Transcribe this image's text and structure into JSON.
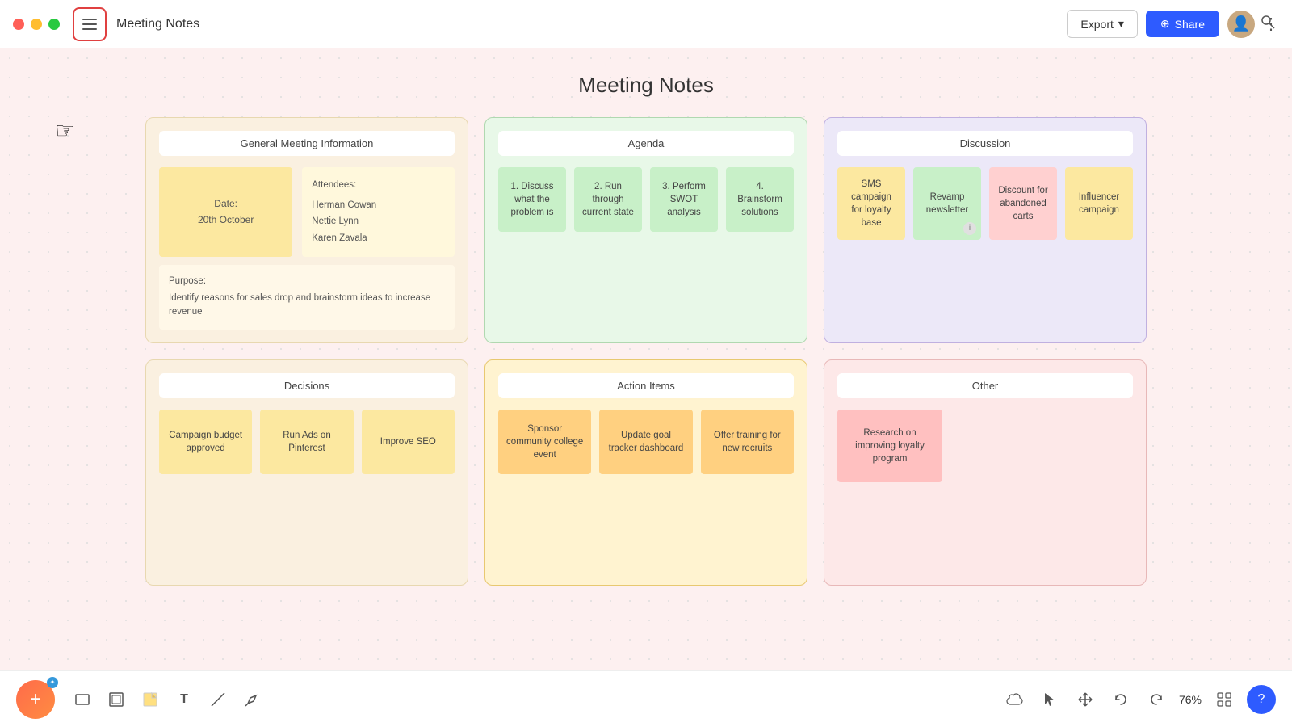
{
  "titleBar": {
    "docTitle": "Meeting Notes",
    "exportLabel": "Export",
    "shareLabel": "Share",
    "moreLabel": "⋮"
  },
  "page": {
    "title": "Meeting Notes"
  },
  "sections": {
    "general": {
      "header": "General Meeting Information",
      "dateLabel": "Date:",
      "dateValue": "20th October",
      "attendeesLabel": "Attendees:",
      "attendee1": "Herman Cowan",
      "attendee2": "Nettie Lynn",
      "attendee3": "Karen Zavala",
      "purposeLabel": "Purpose:",
      "purposeText": "Identify reasons for sales drop and brainstorm ideas to increase revenue"
    },
    "agenda": {
      "header": "Agenda",
      "items": [
        {
          "label": "1. Discuss what the problem is"
        },
        {
          "label": "2. Run through current state"
        },
        {
          "label": "3. Perform SWOT analysis"
        },
        {
          "label": "4. Brainstorm solutions"
        }
      ]
    },
    "discussion": {
      "header": "Discussion",
      "items": [
        {
          "label": "SMS campaign for loyalty base",
          "color": "yellow"
        },
        {
          "label": "Revamp newsletter",
          "color": "green",
          "hasInfo": true
        },
        {
          "label": "Discount for abandoned carts",
          "color": "pink"
        },
        {
          "label": "Influencer campaign",
          "color": "yellow"
        }
      ]
    },
    "decisions": {
      "header": "Decisions",
      "items": [
        {
          "label": "Campaign budget approved"
        },
        {
          "label": "Run Ads on Pinterest"
        },
        {
          "label": "Improve SEO"
        }
      ]
    },
    "action": {
      "header": "Action Items",
      "items": [
        {
          "label": "Sponsor community college event"
        },
        {
          "label": "Update goal tracker dashboard"
        },
        {
          "label": "Offer training for new recruits"
        }
      ]
    },
    "other": {
      "header": "Other",
      "items": [
        {
          "label": "Research on improving loyalty program"
        }
      ]
    }
  },
  "bottomToolbar": {
    "zoomLevel": "76%",
    "tools": [
      "rectangle",
      "frame",
      "sticky",
      "text",
      "line",
      "highlight"
    ]
  },
  "cursor": "☞"
}
